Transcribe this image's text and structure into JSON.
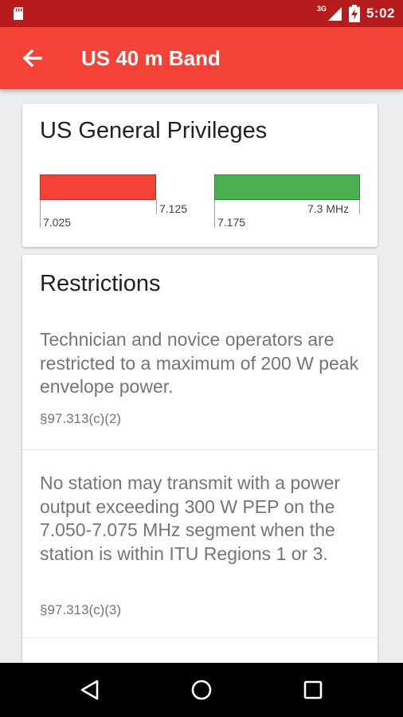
{
  "status_bar": {
    "network_type": "3G",
    "time": "5:02",
    "icons": [
      "sd-card-icon",
      "signal-icon",
      "battery-charging-icon"
    ]
  },
  "app_bar": {
    "title": "US 40 m Band",
    "back_icon": "arrow-back-icon"
  },
  "privileges": {
    "title": "US General Privileges",
    "segments": [
      {
        "start": "7.025",
        "end": "7.125",
        "color": "#F44336"
      },
      {
        "start": "7.175",
        "end": "7.3 MHz",
        "color": "#4CAF50"
      }
    ]
  },
  "restrictions": {
    "title": "Restrictions",
    "items": [
      {
        "text": "Technician and novice operators are restricted to a maximum of 200 W peak envelope power.",
        "reference": "§97.313(c)(2)"
      },
      {
        "text": "No station may transmit with a power output exceeding 300 W PEP on the 7.050-7.075 MHz segment when the station is within ITU Regions 1 or 3.",
        "reference": "§97.313(c)(3)"
      }
    ]
  },
  "nav_bar": {
    "icons": [
      "back-triangle-icon",
      "home-circle-icon",
      "recents-square-icon"
    ]
  }
}
